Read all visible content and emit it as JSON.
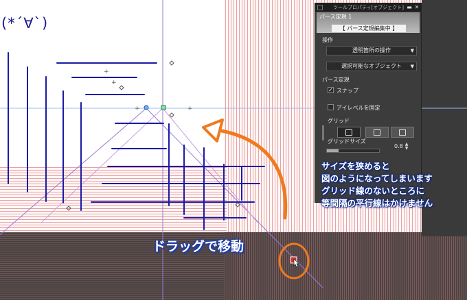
{
  "kaomoji": "(*´∀`)",
  "panel": {
    "title": "ツールプロパティ[オブジェクト]",
    "tab_name": "パース定規 1",
    "mode_label": "【 パース定規編集中 】",
    "operation_label": "操作",
    "operation_value": "透明箇所の操作",
    "selectable_value": "選択可能なオブジェクト",
    "ruler_label": "パース定規",
    "snap_label": "スナップ",
    "snap_checked": "✓",
    "eyelevel_label": "アイレベルを固定",
    "grid_label": "グリッド",
    "grid_size_label": "グリッドサイズ",
    "grid_size_value": "0.8",
    "grid_size_fraction": 0.22
  },
  "annotation": {
    "lines": [
      "サイズを狭めると",
      "図のようになってしまいます",
      "グリッド線のないところに",
      "等間隔の平行線はかけません"
    ]
  },
  "drag_label": "ドラッグで移動",
  "colors": {
    "stroke": "#1a1aa6",
    "arrow": "#f07a1e",
    "grid_pink": "#e8a8a8",
    "guide_purple": "#8b5cc9",
    "annotation_outline": "#0d2a8a"
  }
}
